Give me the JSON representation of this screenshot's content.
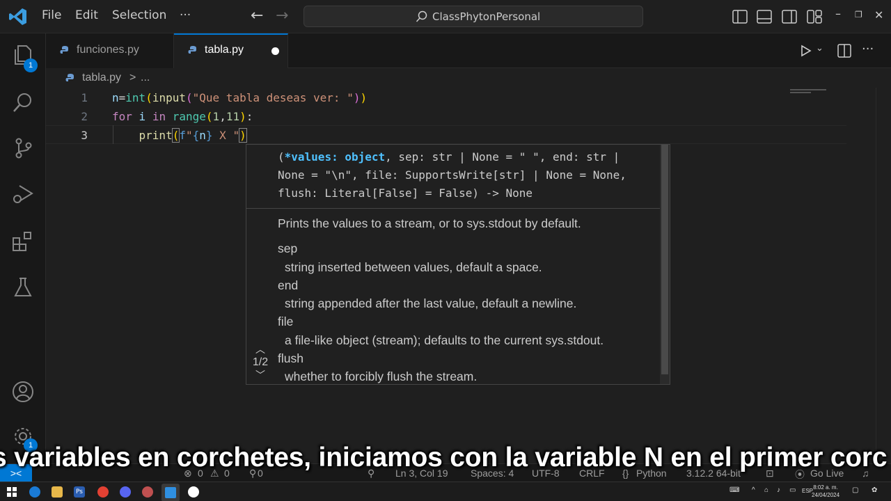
{
  "titlebar": {
    "menu": [
      "File",
      "Edit",
      "Selection",
      "···"
    ],
    "search": "ClassPhytonPersonal"
  },
  "activity": {
    "explorer_badge": "1",
    "settings_badge": "1"
  },
  "tabs": [
    {
      "label": "funciones.py",
      "active": false
    },
    {
      "label": "tabla.py",
      "active": true,
      "modified": true
    }
  ],
  "breadcrumb": {
    "file": "tabla.py",
    "sep": ">",
    "more": "..."
  },
  "editor": {
    "line_numbers": [
      "1",
      "2",
      "3"
    ],
    "lines": [
      "n=int(input(\"Que tabla deseas ver: \"))",
      "for i in range(1,11):",
      "    print(f\"{n} X \")"
    ]
  },
  "signature": {
    "head_l1_a": "(",
    "head_l1_b": "*values: object",
    "head_l1_c": ", sep: str | None = \" \", end: str |",
    "head_l2": "None = \"\\n\", file: SupportsWrite[str] | None = None,",
    "head_l3": "flush: Literal[False] = False) -> None",
    "description": "Prints the values to a stream, or to sys.stdout by default.",
    "params": [
      {
        "name": "sep",
        "desc": "string inserted between values, default a space."
      },
      {
        "name": "end",
        "desc": "string appended after the last value, default a newline."
      },
      {
        "name": "file",
        "desc": "a file-like object (stream); defaults to the current sys.stdout."
      },
      {
        "name": "flush",
        "desc": "whether to forcibly flush the stream."
      }
    ],
    "counter": "1/2"
  },
  "statusbar": {
    "errors": "0",
    "warnings": "0",
    "ports": "0",
    "position": "Ln 3, Col 19",
    "spaces": "Spaces: 4",
    "encoding": "UTF-8",
    "eol": "CRLF",
    "language": "Python",
    "interpreter": "3.12.2 64-bit",
    "golive": "Go Live"
  },
  "subtitle": "s variables en corchetes, iniciamos con la variable N en el primer corc",
  "taskbar": {
    "lang": "ESP",
    "time": "8:02 a. m.",
    "date": "24/04/2024"
  },
  "colors": {
    "accent": "#0078d4",
    "background": "#1f1f1f"
  }
}
